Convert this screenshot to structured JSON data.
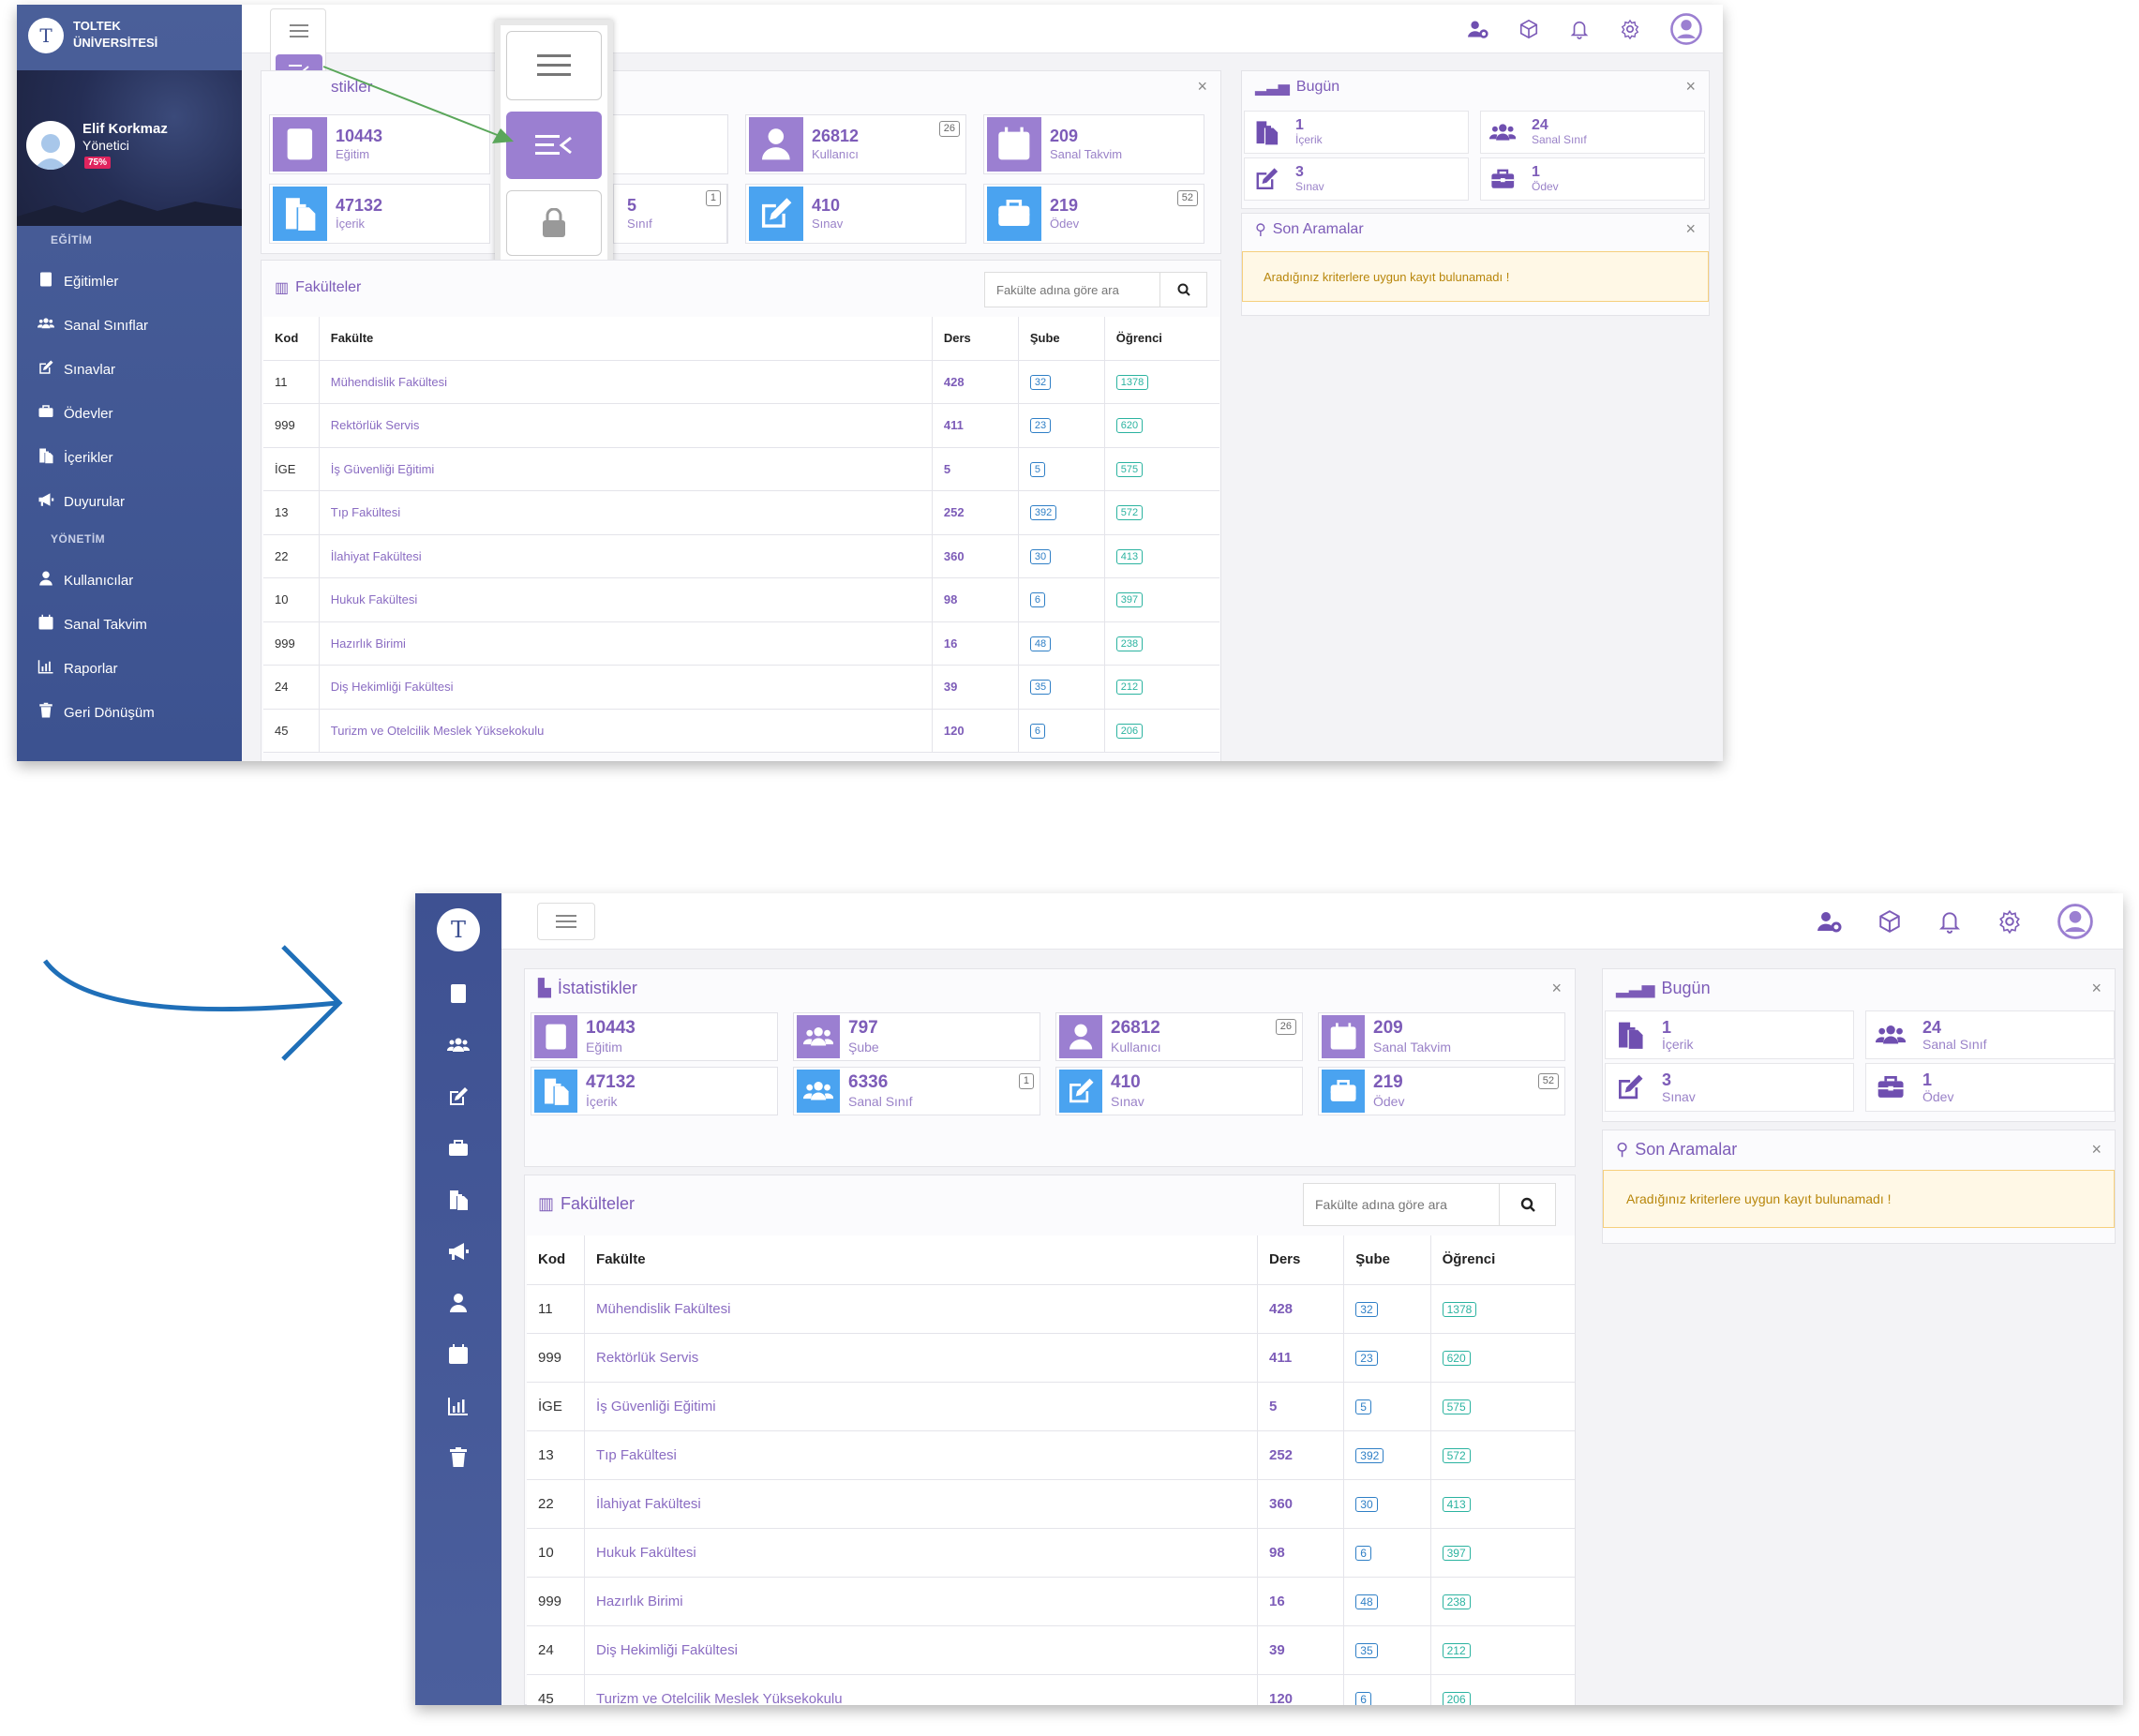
{
  "university": {
    "line1": "TOLTEK",
    "line2": "ÜNİVERSİTESİ",
    "logo_letter": "T"
  },
  "user": {
    "name": "Elif Korkmaz",
    "role": "Yönetici",
    "progress": "75%"
  },
  "sidebar": {
    "section1": "EĞİTİM",
    "section2": "YÖNETİM",
    "items": [
      {
        "label": "Eğitimler",
        "icon": "passport-icon"
      },
      {
        "label": "Sanal Sınıflar",
        "icon": "users-icon"
      },
      {
        "label": "Sınavlar",
        "icon": "edit-icon"
      },
      {
        "label": "Ödevler",
        "icon": "briefcase-icon"
      },
      {
        "label": "İçerikler",
        "icon": "files-icon"
      },
      {
        "label": "Duyurular",
        "icon": "megaphone-icon"
      },
      {
        "label": "Kullanıcılar",
        "icon": "user-icon"
      },
      {
        "label": "Sanal Takvim",
        "icon": "calendar-icon"
      },
      {
        "label": "Raporlar",
        "icon": "chart-icon"
      },
      {
        "label": "Geri Dönüşüm",
        "icon": "trash-icon"
      }
    ]
  },
  "stats": {
    "title": "İstatistikler",
    "title_partial": "stikler",
    "tiles": [
      {
        "num": "10443",
        "label": "Eğitim",
        "badge": ""
      },
      {
        "num": "797",
        "label": "Şube",
        "badge": ""
      },
      {
        "num": "26812",
        "label": "Kullanıcı",
        "badge": "26"
      },
      {
        "num": "209",
        "label": "Sanal Takvim",
        "badge": ""
      },
      {
        "num": "47132",
        "label": "İçerik",
        "badge": ""
      },
      {
        "num": "6336",
        "label": "Sanal Sınıf",
        "badge": "1"
      },
      {
        "num": "410",
        "label": "Sınav",
        "badge": ""
      },
      {
        "num": "219",
        "label": "Ödev",
        "badge": "52"
      }
    ],
    "partial_tile": {
      "num": "5",
      "label": "Sınıf"
    }
  },
  "today": {
    "title": "Bugün",
    "tiles": [
      {
        "num": "1",
        "label": "İçerik"
      },
      {
        "num": "24",
        "label": "Sanal Sınıf"
      },
      {
        "num": "3",
        "label": "Sınav"
      },
      {
        "num": "1",
        "label": "Ödev"
      }
    ]
  },
  "recent": {
    "title": "Son Aramalar",
    "empty": "Aradığınız kriterlere uygun kayıt bulunamadı !"
  },
  "faculties": {
    "title": "Fakülteler",
    "search_placeholder": "Fakülte adına göre ara",
    "columns": [
      "Kod",
      "Fakülte",
      "Ders",
      "Şube",
      "Öğrenci"
    ],
    "rows": [
      [
        "11",
        "Mühendislik Fakültesi",
        "428",
        "32",
        "1378"
      ],
      [
        "999",
        "Rektörlük Servis",
        "411",
        "23",
        "620"
      ],
      [
        "İGE",
        "İş Güvenliği Eğitimi",
        "5",
        "5",
        "575"
      ],
      [
        "13",
        "Tıp Fakültesi",
        "252",
        "392",
        "572"
      ],
      [
        "22",
        "İlahiyat Fakültesi",
        "360",
        "30",
        "413"
      ],
      [
        "10",
        "Hukuk Fakültesi",
        "98",
        "6",
        "397"
      ],
      [
        "999",
        "Hazırlık Birimi",
        "16",
        "48",
        "238"
      ],
      [
        "24",
        "Diş Hekimliği Fakültesi",
        "39",
        "35",
        "212"
      ],
      [
        "45",
        "Turizm ve Otelcilik Meslek Yüksekokulu",
        "120",
        "6",
        "206"
      ]
    ]
  },
  "colors": {
    "purple": "#9b7fd1",
    "blue": "#4aa3f0",
    "sidebar": "#4a5f99",
    "arrow_green": "#5aa65a",
    "arrow_blue": "#1f6fb8"
  }
}
